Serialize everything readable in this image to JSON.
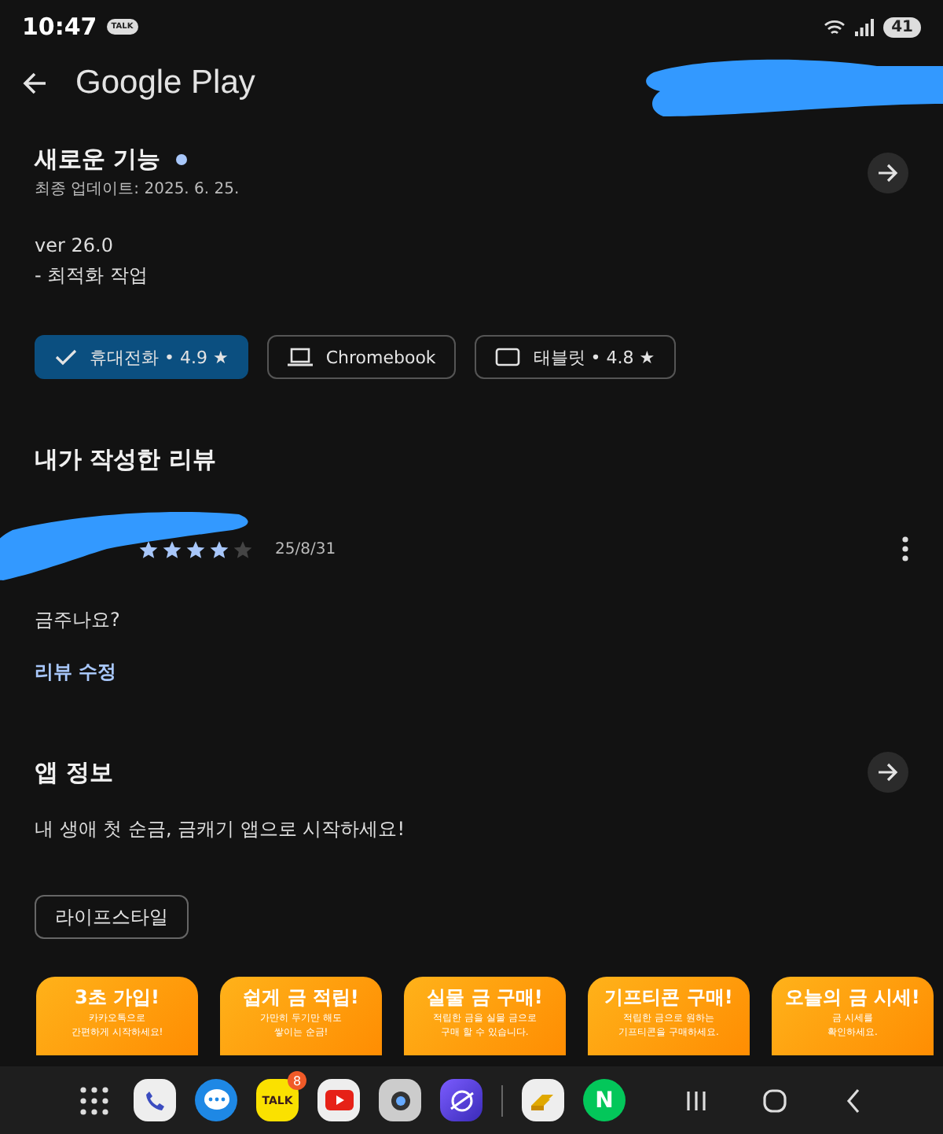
{
  "status_bar": {
    "time": "10:47",
    "notification": "TALK",
    "battery": "41"
  },
  "app_bar": {
    "title": "Google Play"
  },
  "whats_new": {
    "title": "새로운 기능",
    "new": true,
    "updated": "최종 업데이트: 2025. 6. 25.",
    "lines": [
      "ver 26.0",
      "- 최적화 작업"
    ]
  },
  "devices": [
    {
      "label": "휴대전화 • 4.9 ★",
      "selected": true
    },
    {
      "kind": "laptop",
      "label": "Chromebook",
      "selected": false
    },
    {
      "kind": "tablet",
      "label": "태블릿 • 4.8 ★",
      "selected": false
    }
  ],
  "my_review": {
    "title": "내가 작성한 리뷰",
    "stars": 4,
    "date": "25/8/31",
    "text": "금주나요?",
    "edit_link": "리뷰 수정"
  },
  "app_info": {
    "title": "앱 정보",
    "description": "내 생애 첫 순금, 금캐기 앱으로 시작하세요!",
    "category": "라이프스타일"
  },
  "screenshots": [
    {
      "title": "3초 가입!",
      "lines": [
        "카카오톡으로",
        "간편하게 시작하세요!"
      ]
    },
    {
      "title": "쉽게 금 적립!",
      "lines": [
        "가만히 두기만 해도",
        "쌓이는 순금!"
      ]
    },
    {
      "title": "실물 금 구매!",
      "lines": [
        "적립한 금을 실물 금으로",
        "구매 할 수 있습니다."
      ]
    },
    {
      "title": "기프티콘 구매!",
      "lines": [
        "적립한 금으로 원하는",
        "기프티콘을 구매하세요."
      ]
    },
    {
      "title": "오늘의 금 시세!",
      "lines": [
        "금 시세를",
        "확인하세요."
      ]
    }
  ],
  "taskbar": {
    "apps": [
      {
        "kind": "grid"
      },
      {
        "kind": "phone"
      },
      {
        "kind": "messages"
      },
      {
        "kind": "kakao",
        "label": "TALK",
        "badge": "8"
      },
      {
        "kind": "youtube"
      },
      {
        "kind": "camera"
      },
      {
        "kind": "browser"
      },
      {
        "kind": "divider"
      },
      {
        "kind": "gold"
      },
      {
        "kind": "naver",
        "label": "N"
      }
    ]
  }
}
